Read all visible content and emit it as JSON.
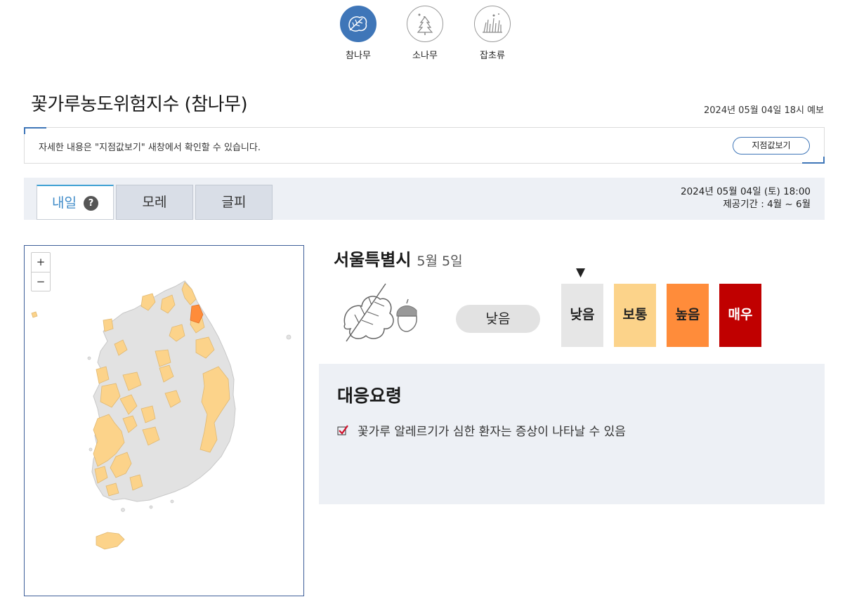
{
  "pollen_types": [
    {
      "label": "참나무",
      "icon": "oak-leaf-icon",
      "active": true
    },
    {
      "label": "소나무",
      "icon": "pine-tree-icon",
      "active": false
    },
    {
      "label": "잡초류",
      "icon": "weed-grass-icon",
      "active": false
    }
  ],
  "page": {
    "title": "꽃가루농도위험지수 (참나무)",
    "forecast_time": "2024년 05월 04일 18시 예보"
  },
  "notice": {
    "text": "자세한 내용은 \"지점값보기\" 새창에서 확인할 수 있습니다.",
    "button_label": "지점값보기"
  },
  "tabs": [
    {
      "label": "내일",
      "active": true,
      "help": "?"
    },
    {
      "label": "모레",
      "active": false
    },
    {
      "label": "글피",
      "active": false
    }
  ],
  "tab_info": {
    "datetime": "2024년 05월 04일 (토) 18:00",
    "period": "제공기간 : 4월 ~ 6월"
  },
  "map": {
    "zoom_in": "+",
    "zoom_out": "−",
    "colors": {
      "low": "#e2e2e2",
      "normal": "#fcd38a",
      "high": "#ff8c3a",
      "very_high": "#c00000"
    }
  },
  "detail": {
    "region": "서울특별시",
    "date": "5월 5일",
    "current_level": "낮음",
    "pointer": "▼"
  },
  "levels": [
    {
      "label": "낮음",
      "color": "#e6e6e6",
      "text_color": "#222222"
    },
    {
      "label": "보통",
      "color": "#fcd38a",
      "text_color": "#222222"
    },
    {
      "label": "높음",
      "color": "#ff8c3a",
      "text_color": "#222222"
    },
    {
      "label": "매우",
      "color": "#c00000",
      "text_color": "#ffffff"
    }
  ],
  "guide": {
    "title": "대응요령",
    "items": [
      "꽃가루 알레르기가 심한 환자는 증상이 나타날 수 있음"
    ]
  }
}
